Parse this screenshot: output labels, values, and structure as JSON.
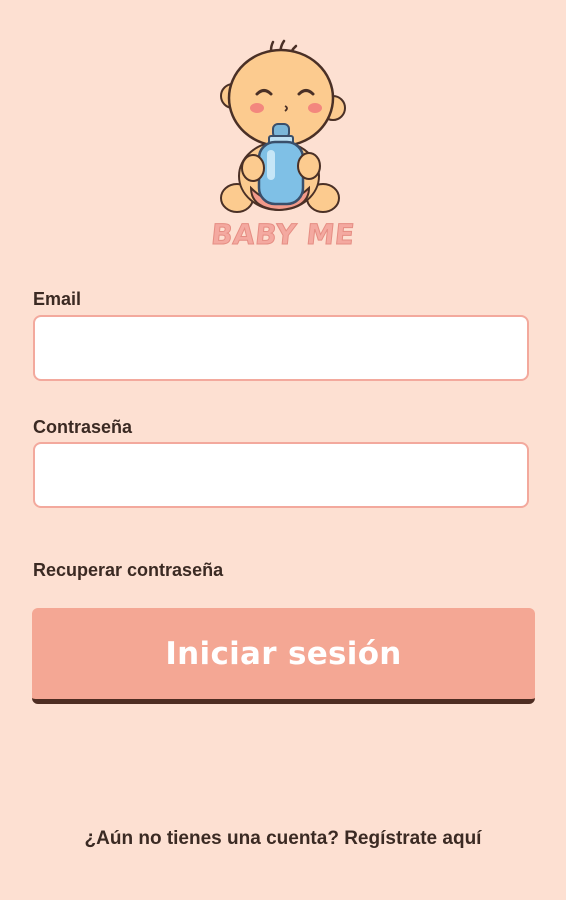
{
  "brand": {
    "name": "BABY ME"
  },
  "form": {
    "email_label": "Email",
    "email_value": "",
    "password_label": "Contraseña",
    "password_value": ""
  },
  "links": {
    "recover_password": "Recuperar contraseña",
    "register": "¿Aún no tienes una cuenta? Regístrate aquí"
  },
  "actions": {
    "login_label": "Iniciar sesión"
  },
  "colors": {
    "background": "#fde0d2",
    "accent": "#f4a794",
    "input_border": "#f3a99d",
    "text": "#3b2a23"
  },
  "icons": {
    "logo": "baby-with-bottle-icon"
  }
}
